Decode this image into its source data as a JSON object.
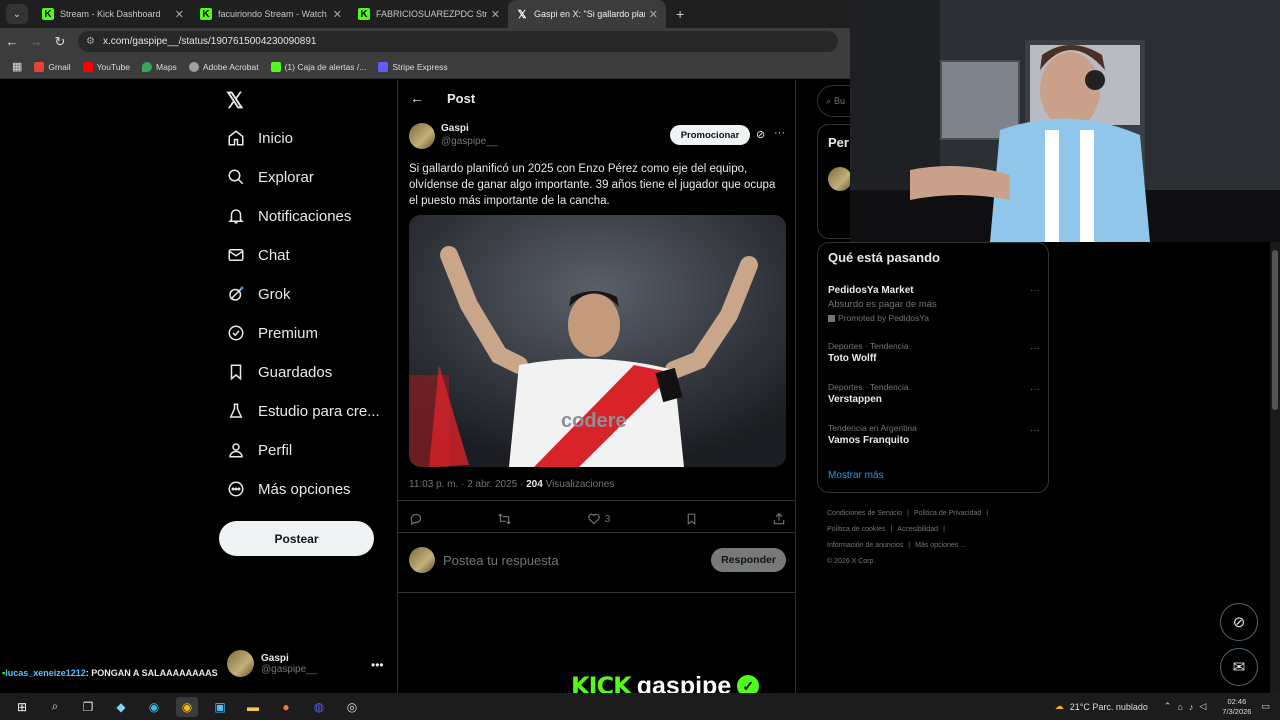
{
  "browser": {
    "tabs": [
      {
        "title": "Stream - Kick Dashboard",
        "favicon": "kick",
        "active": false
      },
      {
        "title": "facuiriondo Stream - Watch Live",
        "favicon": "kick",
        "active": false
      },
      {
        "title": "FABRICIOSUAREZPDC Stream",
        "favicon": "kick",
        "active": false
      },
      {
        "title": "Gaspi en X: \"Si gallardo planific",
        "favicon": "x",
        "active": true
      }
    ],
    "url": "x.com/gaspipe__/status/1907615004230090891",
    "bookmarks": [
      "Gmail",
      "YouTube",
      "Maps",
      "Adobe Acrobat",
      "(1) Caja de alertas /...",
      "Stripe Express"
    ]
  },
  "nav": {
    "items": [
      "Inicio",
      "Explorar",
      "Notificaciones",
      "Chat",
      "Grok",
      "Premium",
      "Guardados",
      "Estudio para cre...",
      "Perfil",
      "Más opciones"
    ],
    "post_button": "Postear",
    "account": {
      "name": "Gaspi",
      "handle": "@gaspipe__"
    }
  },
  "post": {
    "header": "Post",
    "author": {
      "name": "Gaspi",
      "handle": "@gaspipe__"
    },
    "promote_button": "Promocionar",
    "text": "Si gallardo planificó un 2025 con Enzo Pérez como eje del equipo, olvídense de ganar algo importante. 39 años tiene el jugador que ocupa el puesto más importante de la cancha.",
    "media_sponsor": "codere",
    "time": "11:03 p. m. · 2 abr. 2025 · ",
    "views_count": "204",
    "views_label": " Visualizaciones",
    "likes": "3",
    "reply_placeholder": "Postea tu respuesta",
    "reply_button": "Responder"
  },
  "sidebar": {
    "search_partial": "Bu",
    "card_partial": "Per",
    "trends_title": "Qué está pasando",
    "trends": [
      {
        "category": "",
        "name": "PedidosYa Market",
        "subtitle": "Absurdo es pagar de más",
        "promoted": "Promoted by PedidosYa"
      },
      {
        "category": "Deportes · Tendencia",
        "name": "Toto Wolff"
      },
      {
        "category": "Deportes · Tendencia",
        "name": "Verstappen"
      },
      {
        "category": "Tendencia en Argentina",
        "name": "Vamos Franquito"
      }
    ],
    "show_more": "Mostrar más",
    "footer": [
      "Condiciones de Servicio",
      "|",
      "Política de Privacidad",
      "|",
      "Política de cookies",
      "|",
      "Accesibilidad",
      "|",
      "Información de anuncios",
      "|",
      "Más opciones ...",
      "© 2026 X Corp."
    ]
  },
  "overlay": {
    "chat_user": "lucas_xeneize1212",
    "chat_text": ": PONGAN A SALAAAAAAAAS",
    "kick_logo": "KICK",
    "kick_channel": "gaspipe"
  },
  "taskbar": {
    "weather": "21°C  Parc. nublado",
    "time": "02:46",
    "date": "7/3/2026"
  },
  "colors": {
    "kick_green": "#53fc18",
    "x_blue": "#1d9bf0",
    "river_red": "#d8232a"
  }
}
